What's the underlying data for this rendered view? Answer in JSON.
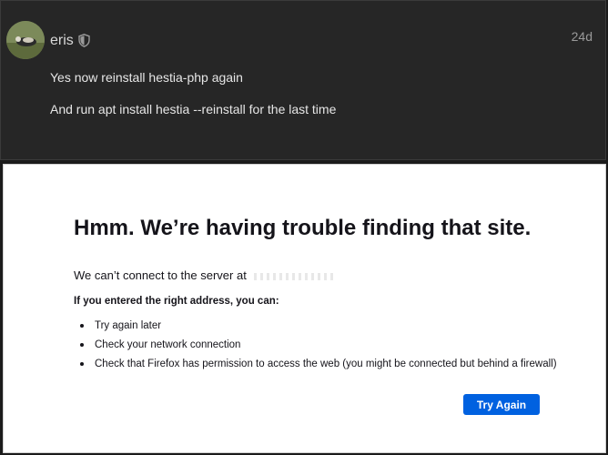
{
  "post": {
    "username": "eris",
    "age": "24d",
    "lines": [
      "Yes now reinstall hestia-php again",
      "And run apt install hestia --reinstall for the last time"
    ]
  },
  "error": {
    "title": "Hmm. We’re having trouble finding that site.",
    "description": "We can’t connect to the server at",
    "suggestions_heading": "If you entered the right address, you can:",
    "suggestions": [
      "Try again later",
      "Check your network connection",
      "Check that Firefox has permission to access the web (you might be connected but behind a firewall)"
    ],
    "try_again_label": "Try Again"
  },
  "colors": {
    "forum_background": "#262626",
    "page_background": "#ffffff",
    "button_accent": "#0061e0",
    "text_dark": "#15141a"
  },
  "icons": {
    "moderator_badge": "shield-icon",
    "avatar": "avatar"
  }
}
